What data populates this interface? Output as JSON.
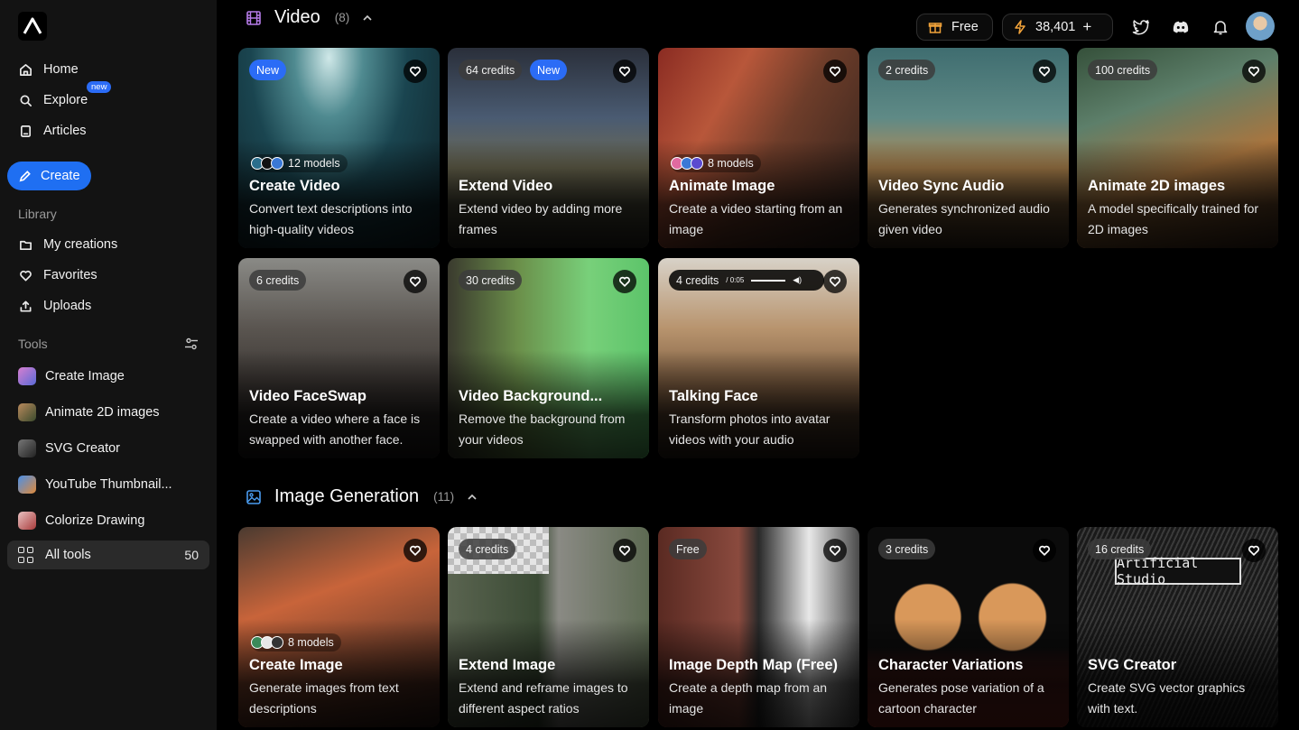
{
  "sidebar": {
    "nav": [
      {
        "label": "Home",
        "icon": "home-icon"
      },
      {
        "label": "Explore",
        "icon": "search-icon",
        "badge": "new"
      },
      {
        "label": "Articles",
        "icon": "article-icon"
      }
    ],
    "create_label": "Create",
    "library_label": "Library",
    "library": [
      {
        "label": "My creations",
        "icon": "folder-icon"
      },
      {
        "label": "Favorites",
        "icon": "heart-icon"
      },
      {
        "label": "Uploads",
        "icon": "upload-icon"
      }
    ],
    "tools_label": "Tools",
    "tools": [
      {
        "label": "Create Image",
        "color": "#c978c4"
      },
      {
        "label": "Animate 2D images",
        "color": "#8a6b4e"
      },
      {
        "label": "SVG Creator",
        "color": "#555555"
      },
      {
        "label": "YouTube Thumbnail...",
        "color": "#3f7fd9"
      },
      {
        "label": "Colorize Drawing",
        "color": "#b24a4a"
      }
    ],
    "all_tools": {
      "label": "All tools",
      "count": "50"
    }
  },
  "topbar": {
    "plan": "Free",
    "credits": "38,401",
    "plus": "+"
  },
  "video_section": {
    "title": "Video",
    "count": "(8)",
    "cards": [
      {
        "pill": "",
        "pill2": "New",
        "models": "12 models",
        "title": "Create Video",
        "desc": "Convert text descriptions into high-quality videos"
      },
      {
        "pill": "64 credits",
        "pill2": "New",
        "title": "Extend Video",
        "desc": "Extend video by adding more frames"
      },
      {
        "pill": "",
        "models": "8 models",
        "title": "Animate Image",
        "desc": "Create a video starting from an image"
      },
      {
        "pill": "2 credits",
        "title": "Video Sync Audio",
        "desc": "Generates synchronized audio given video"
      },
      {
        "pill": "100 credits",
        "title": "Animate 2D images",
        "desc": "A model specifically trained for 2D images"
      },
      {
        "pill": "6 credits",
        "title": "Video FaceSwap",
        "desc": "Create a video where a face is swapped with another face."
      },
      {
        "pill": "30 credits",
        "title": "Video Background...",
        "desc": "Remove the background from your videos"
      },
      {
        "pill": "4 credits",
        "player_time": "/ 0:05",
        "title": "Talking Face",
        "desc": "Transform photos into avatar videos with your audio"
      }
    ]
  },
  "image_section": {
    "title": "Image Generation",
    "count": "(11)",
    "cards": [
      {
        "pill": "",
        "models": "8 models",
        "title": "Create Image",
        "desc": "Generate images from text descriptions"
      },
      {
        "pill": "4 credits",
        "title": "Extend Image",
        "desc": "Extend and reframe images to different aspect ratios"
      },
      {
        "pill": "Free",
        "title": "Image Depth Map (Free)",
        "desc": "Create a depth map from an image"
      },
      {
        "pill": "3 credits",
        "title": "Character Variations",
        "desc": "Generates pose variation of a cartoon character"
      },
      {
        "pill": "16 credits",
        "sign_text": "Artificial Studio",
        "title": "SVG Creator",
        "desc": "Create SVG vector graphics with text."
      }
    ]
  }
}
